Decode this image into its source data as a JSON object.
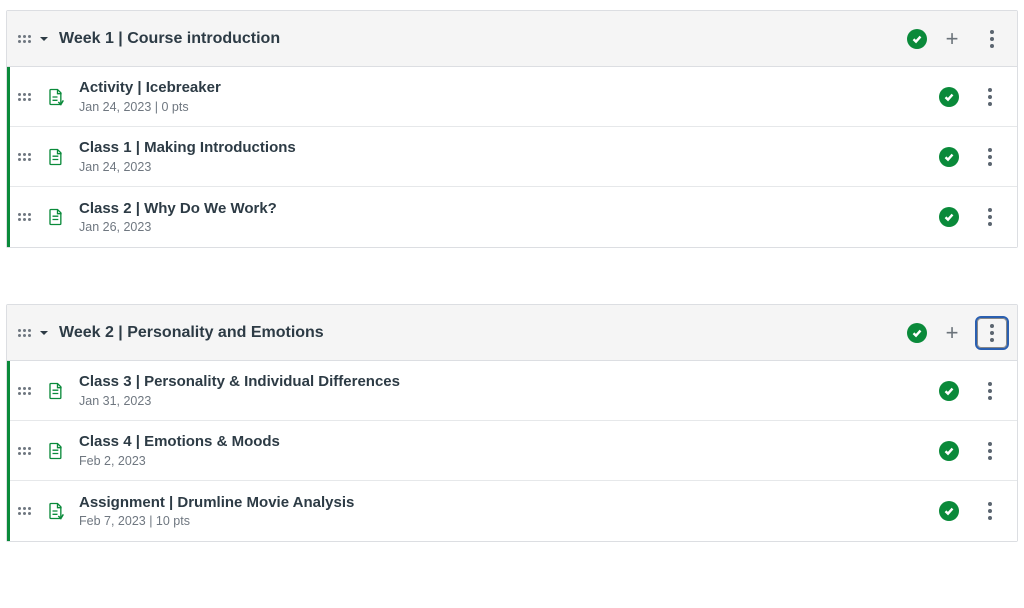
{
  "modules": [
    {
      "title": "Week 1 | Course introduction",
      "kebab_focused": false,
      "items": [
        {
          "icon": "assignment",
          "title": "Activity | Icebreaker",
          "meta": "Jan 24, 2023  |  0 pts"
        },
        {
          "icon": "page",
          "title": "Class 1 | Making Introductions",
          "meta": "Jan 24, 2023"
        },
        {
          "icon": "page",
          "title": "Class 2 | Why Do We Work?",
          "meta": "Jan 26, 2023"
        }
      ]
    },
    {
      "title": "Week 2 | Personality and Emotions",
      "kebab_focused": true,
      "items": [
        {
          "icon": "page",
          "title": "Class 3 | Personality & Individual Differences",
          "meta": "Jan 31, 2023"
        },
        {
          "icon": "page",
          "title": "Class 4 | Emotions & Moods",
          "meta": "Feb 2, 2023"
        },
        {
          "icon": "assignment",
          "title": "Assignment | Drumline Movie Analysis",
          "meta": "Feb 7, 2023  |  10 pts"
        }
      ]
    }
  ]
}
